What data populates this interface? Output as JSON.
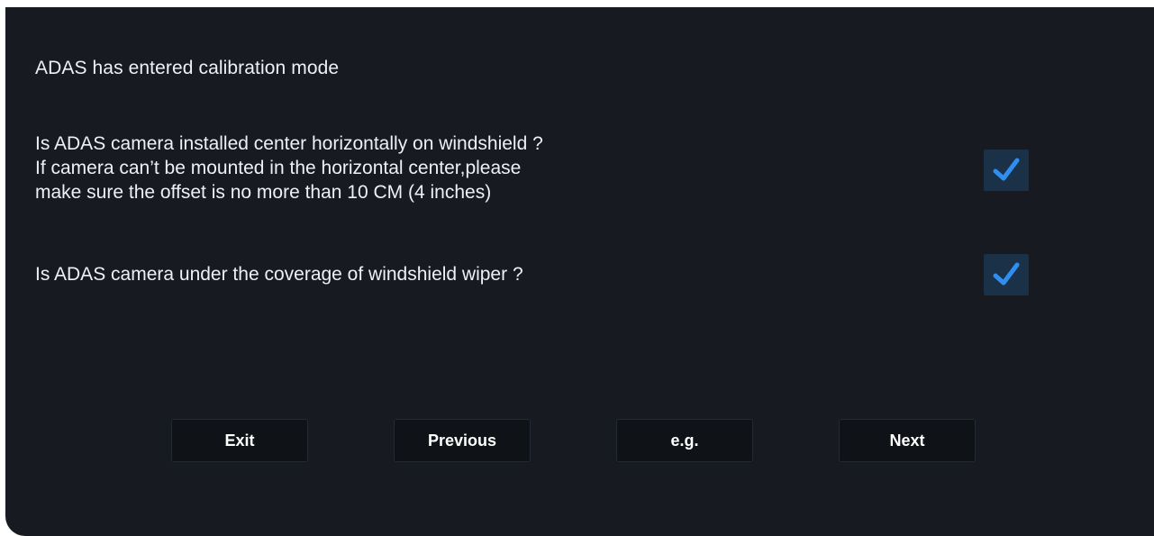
{
  "header": {
    "title": "ADAS has entered calibration mode"
  },
  "questions": [
    {
      "lines": [
        "Is ADAS camera installed center horizontally on windshield ?",
        "If camera can’t be mounted in the horizontal center,please",
        "make sure the offset is no more than 10 CM (4 inches)"
      ],
      "checked": true
    },
    {
      "lines": [
        "Is ADAS camera under the coverage of windshield wiper ?"
      ],
      "checked": true
    }
  ],
  "buttons": {
    "exit": "Exit",
    "previous": "Previous",
    "example": "e.g.",
    "next": "Next"
  },
  "colors": {
    "background": "#171a20",
    "checkbox_fill": "#1b3147",
    "check_mark": "#2f8ff0",
    "button_fill": "#0f1217",
    "text": "#eef0f4"
  },
  "icons": {
    "checkbox": "checkmark-icon"
  }
}
